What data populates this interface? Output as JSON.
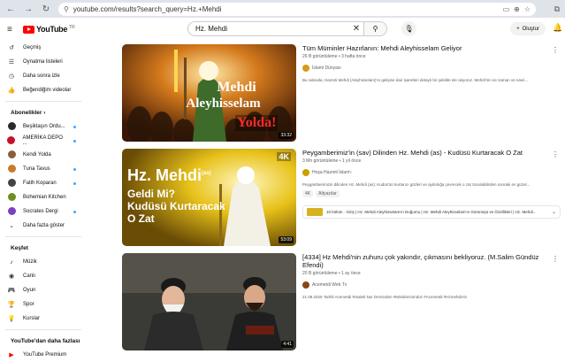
{
  "browser": {
    "url": "youtube.com/results?search_query=Hz.+Mehdi"
  },
  "header": {
    "logo_text": "YouTube",
    "logo_country": "TR",
    "search_query": "Hz. Mehdi",
    "create_label": "Oluştur"
  },
  "sidebar": {
    "top_items": [
      {
        "label": "Geçmiş",
        "icon": "history-icon"
      },
      {
        "label": "Oynatma listeleri",
        "icon": "playlist-icon"
      },
      {
        "label": "Daha sonra izle",
        "icon": "clock-icon"
      },
      {
        "label": "Beğendiğim videolar",
        "icon": "thumbs-up-icon"
      }
    ],
    "subscriptions_title": "Abonelikler",
    "subscriptions": [
      {
        "label": "Beşiktaşın Ordu...",
        "color": "#2a2a2a",
        "dot": true
      },
      {
        "label": "AMERİKA DEPO ...",
        "color": "#c8102e",
        "dot": true
      },
      {
        "label": "Kendi Yolda",
        "color": "#8b5e3c",
        "dot": false
      },
      {
        "label": "Tuna Tavus",
        "color": "#c97a2b",
        "dot": true
      },
      {
        "label": "Fatih Koparan",
        "color": "#444444",
        "dot": true
      },
      {
        "label": "Bohemian Kitchen",
        "color": "#6b8e23",
        "dot": false
      },
      {
        "label": "Socrates Dergi",
        "color": "#7b3fbf",
        "dot": true
      }
    ],
    "show_more": "Daha fazla göster",
    "explore_title": "Keşfet",
    "explore_items": [
      {
        "label": "Müzik",
        "icon": "music-icon"
      },
      {
        "label": "Canlı",
        "icon": "live-icon"
      },
      {
        "label": "Oyun",
        "icon": "gamepad-icon"
      },
      {
        "label": "Spor",
        "icon": "trophy-icon"
      },
      {
        "label": "Kurslar",
        "icon": "courses-icon"
      }
    ],
    "more_title": "YouTube'dan daha fazlası",
    "premium": "YouTube Premium"
  },
  "videos": [
    {
      "title": "Tüm Müminler Hazırlanın: Mehdi Aleyhisselam Geliyor",
      "meta": "26 B görüntüleme • 3 hafta önce",
      "channel": "İslami Dünyası",
      "channel_color": "#d99a1a",
      "description": "Bu videoda, Hazreti Mehdi (Aleyhisselam)'ın gelişine dair işaretleri detaylı bir şekilde ele alıyoruz. Mehdi'nin ne zaman ve nasıl...",
      "duration": "33:32",
      "thumb_line1": "Mehdi",
      "thumb_line2": "Aleyhisselam",
      "thumb_line3": "Yolda!"
    },
    {
      "title": "Peygamberimiz'in (sav) Dilinden Hz. Mehdi (as) - Kudüsü Kurtaracak O Zat",
      "meta": "3 Mn görüntüleme • 1 yıl önce",
      "channel": "Hoşa Hazreti İslam'ı",
      "channel_color": "#c8a000",
      "description": "Peygamberimizin dilinden Hz. Mehdi (as): Kudüs'ün kurtarıcı gözleri ve aydınlığa çevrecek o zat Sorulabilirden sonraki en güzel...",
      "badges": [
        "4K",
        "Altyazılar"
      ],
      "chapters": "10 bölüm · Giriş | Hz. Mehdi Aleyhisselam'ın Doğumu | Hz. Mehdi Aleyhisselam'ın Görünüşü ve Özellikleri | Hz. Mehdi...",
      "duration": "53:09",
      "thumb_tag": "4K",
      "thumb_line1": "Hz. Mehdi",
      "thumb_line1_sup": "(as)",
      "thumb_line2": "Geldi Mi?",
      "thumb_line3": "Kudüsü Kurtaracak",
      "thumb_line4": "O Zat"
    },
    {
      "title": "[4334] Hz Mehdi'nin zuhuru çok yakındır, çıkmasını bekliyoruz. (M.Salim Gündüz Efendi)",
      "meta": "20 B görüntüleme • 1 ay önce",
      "channel": "Acemetdi Web Tv",
      "channel_color": "#8b4513",
      "description": "21.08.2025 Tarihli Acemetdi Risaleti Nur Dersinden #MSalimGündüz #Acemetdi #HzmehdiAS",
      "duration": "4:41"
    }
  ]
}
